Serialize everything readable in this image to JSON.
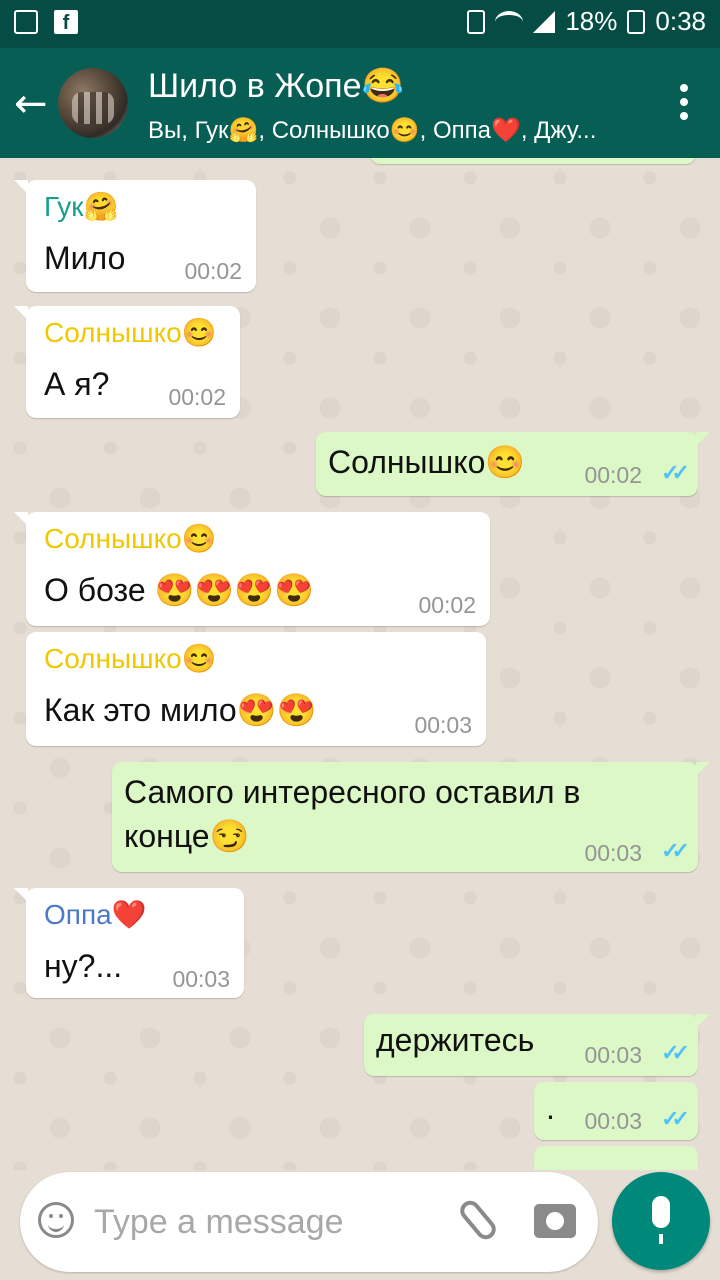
{
  "status_bar": {
    "battery": "18%",
    "time": "0:38"
  },
  "header": {
    "title": "Шило в Жопе😂",
    "participants": "Вы, Гук🤗, Солнышко😊, Оппа❤️, Джу..."
  },
  "colors": {
    "header": "#075e54",
    "status_bar": "#054d44",
    "incoming": "#ffffff",
    "outgoing": "#dcf8c6",
    "tick": "#4fc3f7"
  },
  "messages": [
    {
      "sender": "Гук🤗",
      "sender_color": "#1a9e8c",
      "text": "Мило",
      "time": "00:02"
    },
    {
      "sender": "Солнышко😊",
      "sender_color": "#f0c800",
      "text": "А я?",
      "time": "00:02"
    },
    {
      "text": "Солнышко😊",
      "time": "00:02"
    },
    {
      "sender": "Солнышко😊",
      "sender_color": "#f0c800",
      "text": "О бозе 😍😍😍😍",
      "time": "00:02"
    },
    {
      "sender": "Солнышко😊",
      "sender_color": "#f0c800",
      "text": "Как это мило😍😍",
      "time": "00:03"
    },
    {
      "text_line1": "Самого интересного оставил в",
      "text_line2": "конце😏",
      "time": "00:03"
    },
    {
      "sender": "Оппа❤️",
      "sender_color": "#4a7ac7",
      "text": "ну?...",
      "time": "00:03"
    },
    {
      "text": "держитесь",
      "time": "00:03"
    },
    {
      "text": ".",
      "time": "00:03"
    }
  ],
  "composer": {
    "placeholder": "Type a message"
  }
}
